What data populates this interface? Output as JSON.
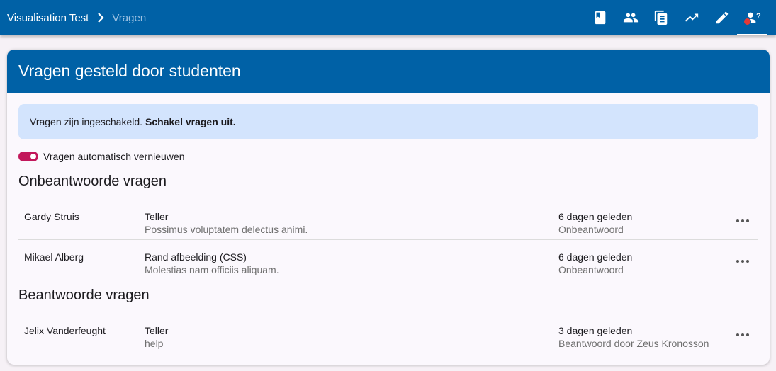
{
  "topbar": {
    "breadcrumb": [
      "Visualisation Test",
      "Vragen"
    ],
    "nav_icons": [
      "book-icon",
      "people-icon",
      "document-icon",
      "trending-up-icon",
      "pencil-icon",
      "question-user-icon"
    ],
    "accent_color": "#0061a6"
  },
  "card": {
    "title": "Vragen gesteld door studenten",
    "alert": {
      "text": "Vragen zijn ingeschakeld.",
      "link": "Schakel vragen uit."
    },
    "toggle": {
      "label": "Vragen automatisch vernieuwen",
      "on": true,
      "color": "#c2185b"
    },
    "unanswered": {
      "title": "Onbeantwoorde vragen",
      "rows": [
        {
          "name": "Gardy Struis",
          "subject": "Teller",
          "preview": "Possimus voluptatem delectus animi.",
          "time": "6 dagen geleden",
          "status": "Onbeantwoord"
        },
        {
          "name": "Mikael Alberg",
          "subject": "Rand afbeelding (CSS)",
          "preview": "Molestias nam officiis aliquam.",
          "time": "6 dagen geleden",
          "status": "Onbeantwoord"
        }
      ]
    },
    "answered": {
      "title": "Beantwoorde vragen",
      "rows": [
        {
          "name": "Jelix Vanderfeught",
          "subject": "Teller",
          "preview": "help",
          "time": "3 dagen geleden",
          "status": "Beantwoord door Zeus Kronosson"
        }
      ]
    }
  }
}
